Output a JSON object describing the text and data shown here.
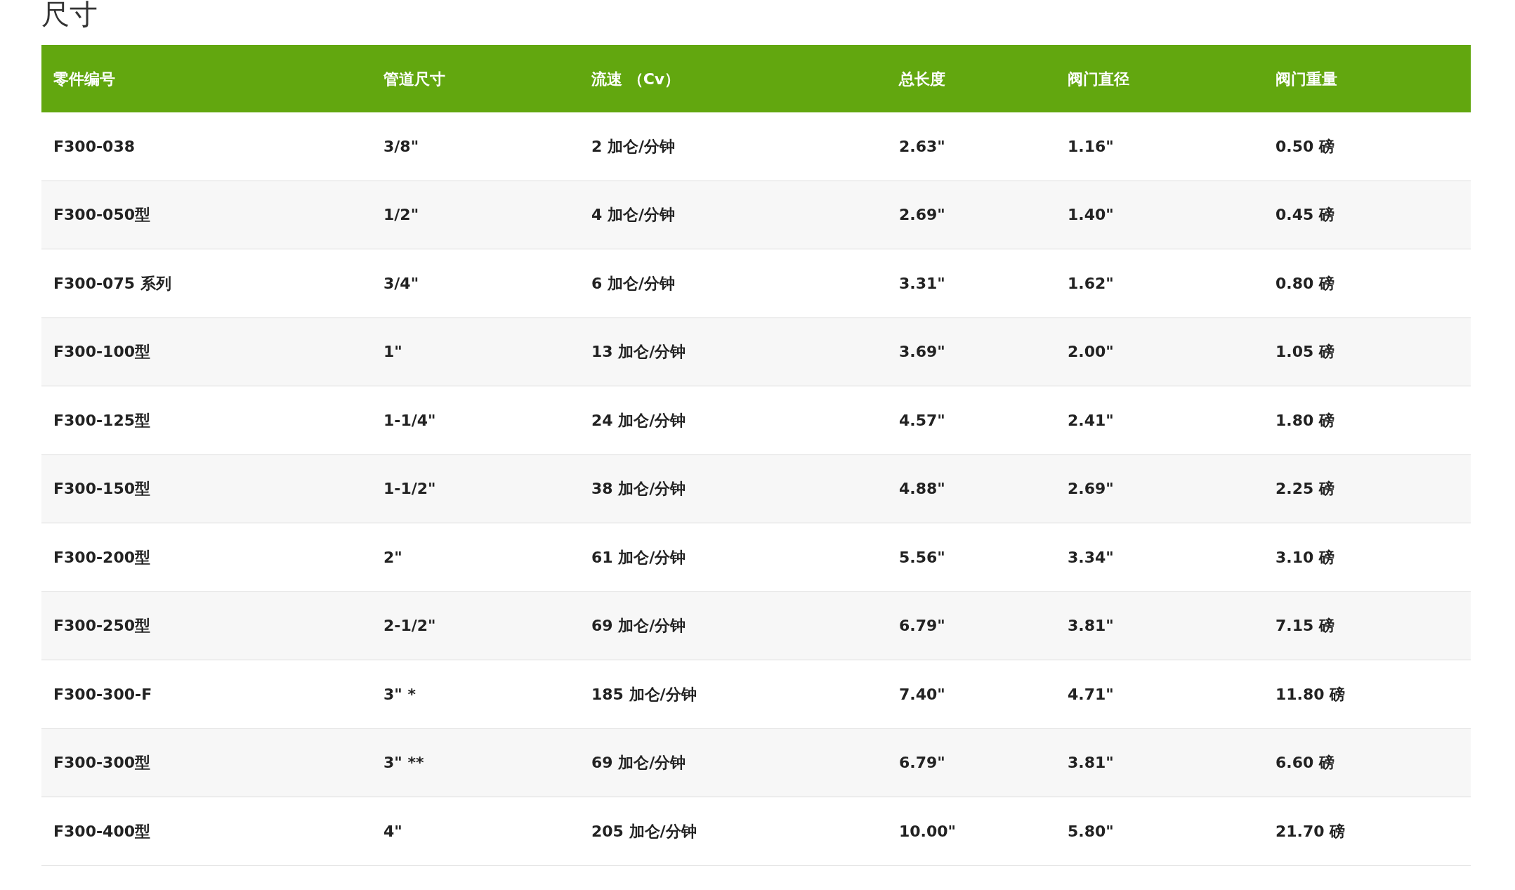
{
  "title": "尺寸",
  "table": {
    "columns": [
      "零件编号",
      "管道尺寸",
      "流速 （Cv）",
      "总长度",
      "阀门直径",
      "阀门重量"
    ],
    "rows": [
      [
        "F300-038",
        "3/8\"",
        "2 加仑/分钟",
        "2.63\"",
        "1.16\"",
        "0.50 磅"
      ],
      [
        "F300-050型",
        "1/2\"",
        "4 加仑/分钟",
        "2.69\"",
        "1.40\"",
        "0.45 磅"
      ],
      [
        "F300-075 系列",
        "3/4\"",
        "6 加仑/分钟",
        "3.31\"",
        "1.62\"",
        "0.80 磅"
      ],
      [
        "F300-100型",
        "1\"",
        "13 加仑/分钟",
        "3.69\"",
        "2.00\"",
        "1.05 磅"
      ],
      [
        "F300-125型",
        "1-1/4\"",
        "24 加仑/分钟",
        "4.57\"",
        "2.41\"",
        "1.80 磅"
      ],
      [
        "F300-150型",
        "1-1/2\"",
        "38 加仑/分钟",
        "4.88\"",
        "2.69\"",
        "2.25 磅"
      ],
      [
        "F300-200型",
        "2\"",
        "61 加仑/分钟",
        "5.56\"",
        "3.34\"",
        "3.10 磅"
      ],
      [
        "F300-250型",
        "2-1/2\"",
        "69 加仑/分钟",
        "6.79\"",
        "3.81\"",
        "7.15 磅"
      ],
      [
        "F300-300-F",
        "3\" *",
        "185 加仑/分钟",
        "7.40\"",
        "4.71\"",
        "11.80 磅"
      ],
      [
        "F300-300型",
        "3\" **",
        "69 加仑/分钟",
        "6.79\"",
        "3.81\"",
        "6.60 磅"
      ],
      [
        "F300-400型",
        "4\"",
        "205 加仑/分钟",
        "10.00\"",
        "5.80\"",
        "21.70 磅"
      ]
    ]
  }
}
